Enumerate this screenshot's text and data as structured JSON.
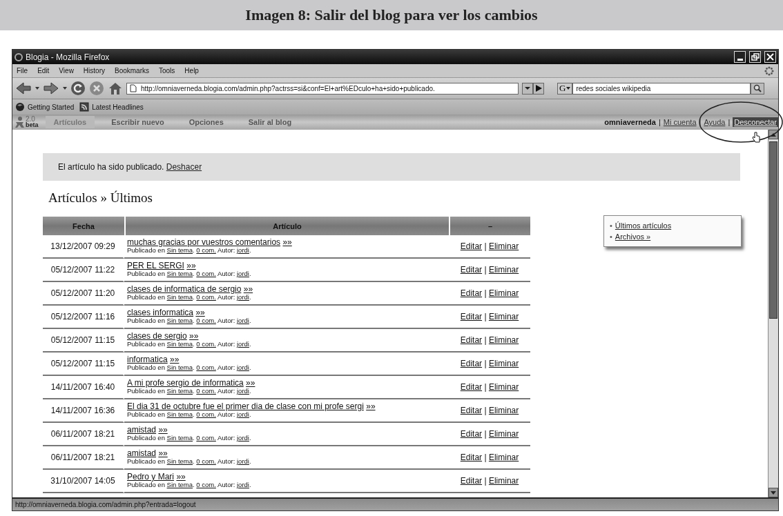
{
  "caption": "Imagen 8: Salir del blog para ver los cambios",
  "window": {
    "title": "Blogia - Mozilla Firefox"
  },
  "menu": [
    "File",
    "Edit",
    "View",
    "History",
    "Bookmarks",
    "Tools",
    "Help"
  ],
  "address": {
    "value": "http://omniaverneda.blogia.com/admin.php?actrss=si&conf=El+art%EDculo+ha+sido+publicado."
  },
  "search": {
    "engine": "G",
    "value": "redes sociales wikipedia"
  },
  "bookmarks": [
    "Getting Started",
    "Latest Headlines"
  ],
  "blog_nav": {
    "logo_version": "2.0",
    "logo_tag": "beta",
    "tabs": [
      {
        "label": "Artículos",
        "selected": true
      },
      {
        "label": "Escribir nuevo",
        "selected": false
      },
      {
        "label": "Opciones",
        "selected": false
      },
      {
        "label": "Salir al blog",
        "selected": false
      }
    ]
  },
  "user": {
    "name": "omniaverneda",
    "separator": "|",
    "links": [
      {
        "label": "Mi cuenta",
        "hovered": false
      },
      {
        "label": "Ayuda",
        "hovered": false
      },
      {
        "label": "Desconectar",
        "hovered": true
      }
    ]
  },
  "notice": {
    "text": "El artículo ha sido publicado.",
    "link": "Deshacer"
  },
  "heading": "Artículos » Últimos",
  "table": {
    "columns": [
      "Fecha",
      "Artículo",
      "–"
    ],
    "rows": [
      {
        "date": "13/12/2007 09:29",
        "title": "muchas gracias por vuestros comentarios",
        "more": "»»",
        "meta": [
          {
            "kind": "text",
            "text": "Publicado en "
          },
          {
            "kind": "link",
            "text": "Sin tema"
          },
          {
            "kind": "text",
            "text": ". "
          },
          {
            "kind": "link",
            "text": "0 com."
          },
          {
            "kind": "text",
            "text": " Autor: "
          },
          {
            "kind": "link",
            "text": "jordi"
          },
          {
            "kind": "text",
            "text": "."
          }
        ],
        "edit": "Editar",
        "separator": "|",
        "delete": "Eliminar"
      },
      {
        "date": "05/12/2007 11:22",
        "title": "PER EL SERGI",
        "more": "»»",
        "meta": [
          {
            "kind": "text",
            "text": "Publicado en "
          },
          {
            "kind": "link",
            "text": "Sin tema"
          },
          {
            "kind": "text",
            "text": ". "
          },
          {
            "kind": "link",
            "text": "0 com."
          },
          {
            "kind": "text",
            "text": " Autor: "
          },
          {
            "kind": "link",
            "text": "jordi"
          },
          {
            "kind": "text",
            "text": "."
          }
        ],
        "edit": "Editar",
        "separator": "|",
        "delete": "Eliminar"
      },
      {
        "date": "05/12/2007 11:20",
        "title": "clases de informatica de sergio",
        "more": "»»",
        "meta": [
          {
            "kind": "text",
            "text": "Publicado en "
          },
          {
            "kind": "link",
            "text": "Sin tema"
          },
          {
            "kind": "text",
            "text": ". "
          },
          {
            "kind": "link",
            "text": "0 com."
          },
          {
            "kind": "text",
            "text": " Autor: "
          },
          {
            "kind": "link",
            "text": "jordi"
          },
          {
            "kind": "text",
            "text": "."
          }
        ],
        "edit": "Editar",
        "separator": "|",
        "delete": "Eliminar"
      },
      {
        "date": "05/12/2007 11:16",
        "title": "clases informatica",
        "more": "»»",
        "meta": [
          {
            "kind": "text",
            "text": "Publicado en "
          },
          {
            "kind": "link",
            "text": "Sin tema"
          },
          {
            "kind": "text",
            "text": ". "
          },
          {
            "kind": "link",
            "text": "0 com."
          },
          {
            "kind": "text",
            "text": " Autor: "
          },
          {
            "kind": "link",
            "text": "jordi"
          },
          {
            "kind": "text",
            "text": "."
          }
        ],
        "edit": "Editar",
        "separator": "|",
        "delete": "Eliminar"
      },
      {
        "date": "05/12/2007 11:15",
        "title": "clases de sergio",
        "more": "»»",
        "meta": [
          {
            "kind": "text",
            "text": "Publicado en "
          },
          {
            "kind": "link",
            "text": "Sin tema"
          },
          {
            "kind": "text",
            "text": ". "
          },
          {
            "kind": "link",
            "text": "0 com."
          },
          {
            "kind": "text",
            "text": " Autor: "
          },
          {
            "kind": "link",
            "text": "jordi"
          },
          {
            "kind": "text",
            "text": "."
          }
        ],
        "edit": "Editar",
        "separator": "|",
        "delete": "Eliminar"
      },
      {
        "date": "05/12/2007 11:15",
        "title": "informatica",
        "more": "»»",
        "meta": [
          {
            "kind": "text",
            "text": "Publicado en "
          },
          {
            "kind": "link",
            "text": "Sin tema"
          },
          {
            "kind": "text",
            "text": ". "
          },
          {
            "kind": "link",
            "text": "0 com."
          },
          {
            "kind": "text",
            "text": " Autor: "
          },
          {
            "kind": "link",
            "text": "jordi"
          },
          {
            "kind": "text",
            "text": "."
          }
        ],
        "edit": "Editar",
        "separator": "|",
        "delete": "Eliminar"
      },
      {
        "date": "14/11/2007 16:40",
        "title": "A mi profe sergio de informatica",
        "more": "»»",
        "meta": [
          {
            "kind": "text",
            "text": "Publicado en "
          },
          {
            "kind": "link",
            "text": "Sin tema"
          },
          {
            "kind": "text",
            "text": ". "
          },
          {
            "kind": "link",
            "text": "0 com."
          },
          {
            "kind": "text",
            "text": " Autor: "
          },
          {
            "kind": "link",
            "text": "jordi"
          },
          {
            "kind": "text",
            "text": "."
          }
        ],
        "edit": "Editar",
        "separator": "|",
        "delete": "Eliminar"
      },
      {
        "date": "14/11/2007 16:36",
        "title": "El dia 31 de octubre fue el primer dia de clase con mi profe sergi",
        "more": "»»",
        "meta": [
          {
            "kind": "text",
            "text": "Publicado en "
          },
          {
            "kind": "link",
            "text": "Sin tema"
          },
          {
            "kind": "text",
            "text": ". "
          },
          {
            "kind": "link",
            "text": "0 com."
          },
          {
            "kind": "text",
            "text": " Autor: "
          },
          {
            "kind": "link",
            "text": "jordi"
          },
          {
            "kind": "text",
            "text": "."
          }
        ],
        "edit": "Editar",
        "separator": "|",
        "delete": "Eliminar"
      },
      {
        "date": "06/11/2007 18:21",
        "title": "amistad",
        "more": "»»",
        "meta": [
          {
            "kind": "text",
            "text": "Publicado en "
          },
          {
            "kind": "link",
            "text": "Sin tema"
          },
          {
            "kind": "text",
            "text": ". "
          },
          {
            "kind": "link",
            "text": "0 com."
          },
          {
            "kind": "text",
            "text": " Autor: "
          },
          {
            "kind": "link",
            "text": "jordi"
          },
          {
            "kind": "text",
            "text": "."
          }
        ],
        "edit": "Editar",
        "separator": "|",
        "delete": "Eliminar"
      },
      {
        "date": "06/11/2007 18:21",
        "title": "amistad",
        "more": "»»",
        "meta": [
          {
            "kind": "text",
            "text": "Publicado en "
          },
          {
            "kind": "link",
            "text": "Sin tema"
          },
          {
            "kind": "text",
            "text": ". "
          },
          {
            "kind": "link",
            "text": "0 com."
          },
          {
            "kind": "text",
            "text": " Autor: "
          },
          {
            "kind": "link",
            "text": "jordi"
          },
          {
            "kind": "text",
            "text": "."
          }
        ],
        "edit": "Editar",
        "separator": "|",
        "delete": "Eliminar"
      },
      {
        "date": "31/10/2007 14:05",
        "title": "Pedro y Mari",
        "more": "»»",
        "meta": [
          {
            "kind": "text",
            "text": "Publicado en "
          },
          {
            "kind": "link",
            "text": "Sin tema"
          },
          {
            "kind": "text",
            "text": ". "
          },
          {
            "kind": "link",
            "text": "0 com."
          },
          {
            "kind": "text",
            "text": " Autor: "
          },
          {
            "kind": "link",
            "text": "jordi"
          },
          {
            "kind": "text",
            "text": "."
          }
        ],
        "edit": "Editar",
        "separator": "|",
        "delete": "Eliminar"
      }
    ]
  },
  "sidebar": [
    {
      "bullet": "•",
      "label": "Últimos artículos"
    },
    {
      "bullet": "•",
      "label": "Archivos »"
    }
  ],
  "status_bar": "http://omniaverneda.blogia.com/admin.php?entrada=logout"
}
